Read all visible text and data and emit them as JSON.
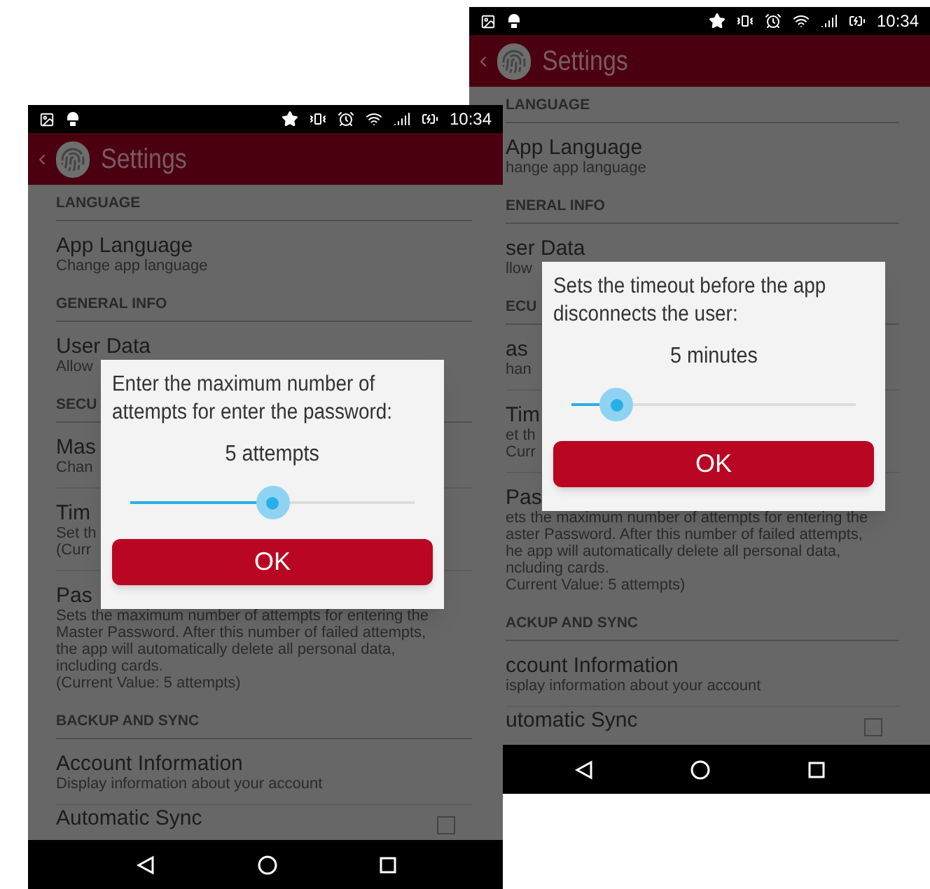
{
  "phones": [
    {
      "status_bar": {
        "time": "10:34"
      },
      "header": {
        "title": "Settings"
      },
      "items": [
        {
          "kind": "section",
          "title": "LANGUAGE"
        },
        {
          "kind": "pref",
          "title": "App Language",
          "summary": [
            "Change app language"
          ]
        },
        {
          "kind": "section",
          "title": "GENERAL INFO"
        },
        {
          "kind": "pref",
          "title": "User Data",
          "summary": [
            "Allow"
          ]
        },
        {
          "kind": "section",
          "title": "SECU"
        },
        {
          "kind": "pref",
          "title": "Mas",
          "summary": [
            "Chan"
          ]
        },
        {
          "kind": "pref",
          "title": "Tim",
          "summary": [
            "Set th",
            "(Curr"
          ]
        },
        {
          "kind": "pref",
          "title": "Pas",
          "summary": [
            "Sets the maximum number of attempts for entering the",
            "Master Password. After this number of failed attempts,",
            "the app will automatically delete all personal data,",
            "including cards.",
            "(Current Value: 5 attempts)"
          ]
        },
        {
          "kind": "section",
          "title": "BACKUP AND SYNC"
        },
        {
          "kind": "pref",
          "title": "Account Information",
          "summary": [
            "Display information about your account"
          ]
        },
        {
          "kind": "checkbox",
          "title": "Automatic Sync",
          "checked": false
        }
      ],
      "dialog": {
        "message": "Enter the maximum number of attempts for enter the password:",
        "value": "5 attempts",
        "slider": {
          "level": 0.5
        },
        "button": "OK"
      }
    },
    {
      "status_bar": {
        "time": "10:34"
      },
      "header": {
        "title": "Settings"
      },
      "items": [
        {
          "kind": "section",
          "title": "LANGUAGE"
        },
        {
          "kind": "pref",
          "title": "App Language",
          "summary": [
            "hange app language"
          ]
        },
        {
          "kind": "section",
          "title": "ENERAL INFO"
        },
        {
          "kind": "pref",
          "title": "ser Data",
          "summary": [
            "llow"
          ]
        },
        {
          "kind": "section",
          "title": "ECU"
        },
        {
          "kind": "pref",
          "title": "as",
          "summary": [
            "han"
          ]
        },
        {
          "kind": "pref",
          "title": "Tim",
          "summary": [
            "et th",
            "Curr"
          ]
        },
        {
          "kind": "pref",
          "title": "Pas",
          "summary": [
            "ets the maximum number of attempts for entering the",
            "aster Password. After this number of failed attempts,",
            "he app will automatically delete all personal data,",
            "ncluding cards.",
            "Current Value: 5 attempts)"
          ]
        },
        {
          "kind": "section",
          "title": "ACKUP AND SYNC"
        },
        {
          "kind": "pref",
          "title": "ccount Information",
          "summary": [
            "isplay information about your account"
          ]
        },
        {
          "kind": "checkbox",
          "title": "utomatic Sync",
          "checked": false
        }
      ],
      "dialog": {
        "message": "Sets the timeout before the app disconnects the user:",
        "value": "5 minutes",
        "slider": {
          "level": 0.16
        },
        "button": "OK"
      }
    }
  ]
}
